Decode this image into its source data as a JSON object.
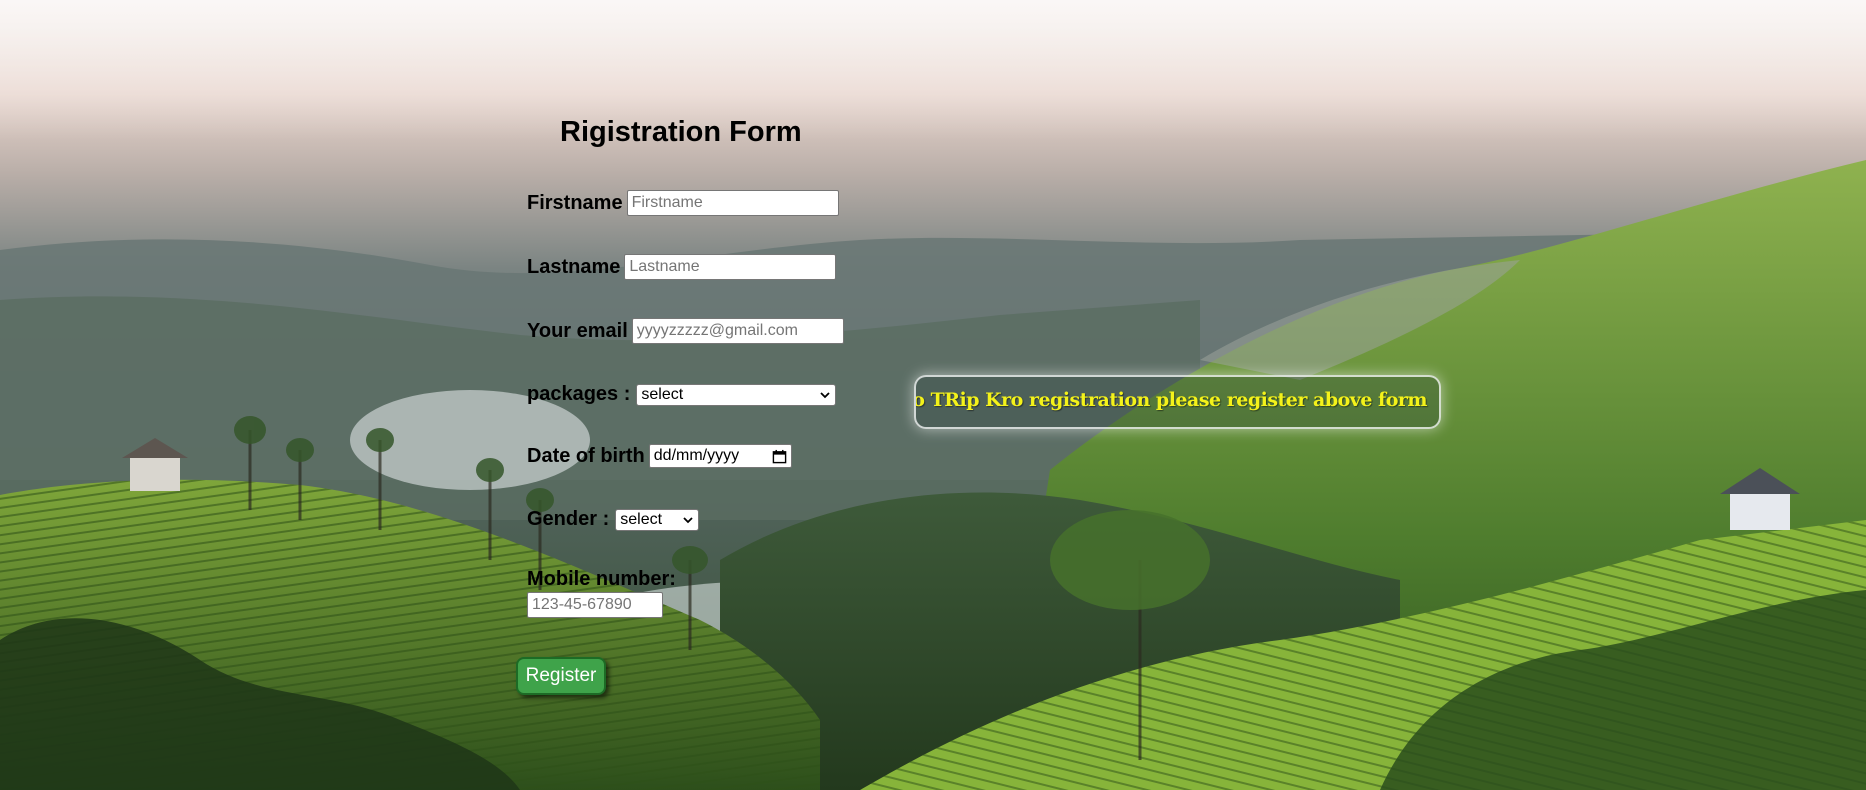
{
  "form": {
    "title": "Rigistration Form",
    "firstname": {
      "label": "Firstname",
      "placeholder": "Firstname"
    },
    "lastname": {
      "label": "Lastname",
      "placeholder": "Lastname"
    },
    "email": {
      "label": "Your email",
      "placeholder": "yyyyzzzzz@gmail.com"
    },
    "packages": {
      "label": "packages :",
      "selected": "select"
    },
    "dob": {
      "label": "Date of birth",
      "placeholder": "dd/mm/yyyy"
    },
    "gender": {
      "label": "Gender :",
      "selected": "select"
    },
    "mobile": {
      "label": "Mobile number:",
      "placeholder": "123-45-67890"
    },
    "register_label": "Register"
  },
  "marquee": {
    "text": "Welcome to TRip Kro registration please register above form"
  },
  "colors": {
    "button_green": "#3fa34a",
    "marquee_text": "#f4f21a"
  },
  "icons": {
    "select_arrow": "chevron-down-icon",
    "date_picker": "calendar-icon"
  }
}
